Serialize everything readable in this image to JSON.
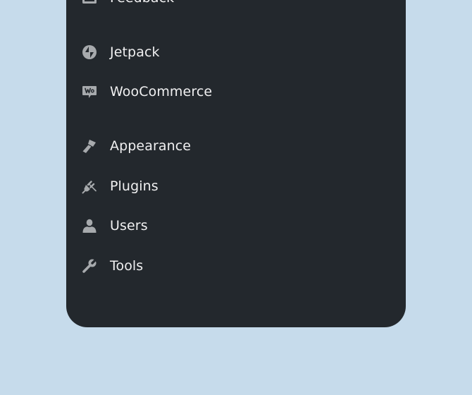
{
  "colors": {
    "background": "#c6dbeb",
    "panel": "#23282d",
    "icon": "#a7aaad",
    "text": "#f0f0f1"
  },
  "menu": {
    "items": [
      {
        "label": "Feedback",
        "icon": "feedback-icon"
      },
      {
        "label": "Jetpack",
        "icon": "jetpack-icon"
      },
      {
        "label": "WooCommerce",
        "icon": "woocommerce-icon"
      },
      {
        "label": "Appearance",
        "icon": "appearance-icon"
      },
      {
        "label": "Plugins",
        "icon": "plugins-icon"
      },
      {
        "label": "Users",
        "icon": "users-icon"
      },
      {
        "label": "Tools",
        "icon": "tools-icon"
      }
    ]
  }
}
